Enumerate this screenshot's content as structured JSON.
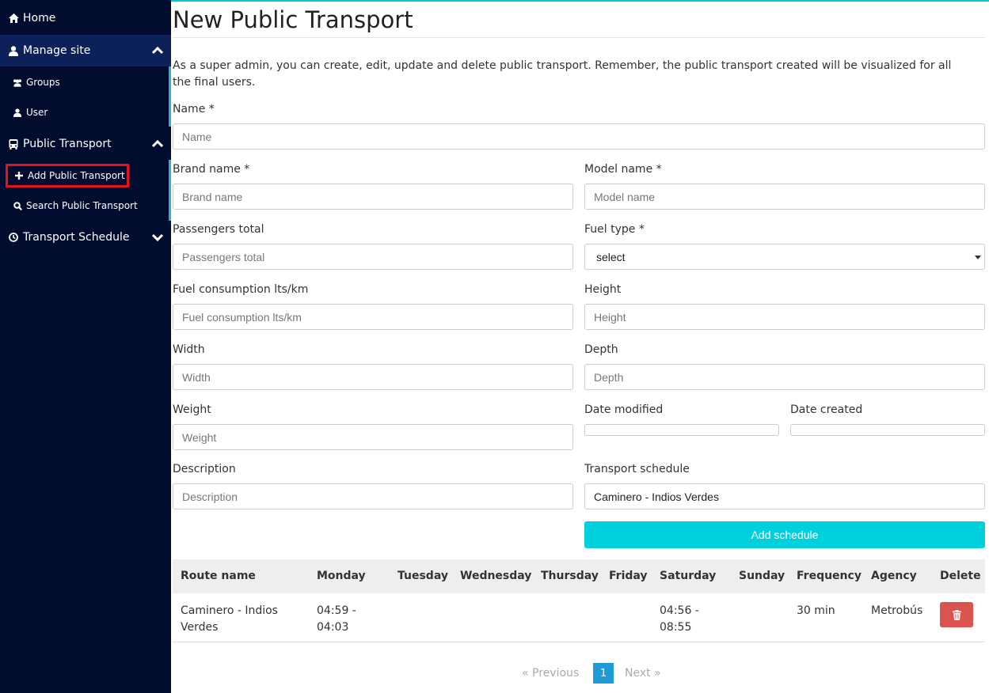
{
  "sidebar": {
    "home": "Home",
    "manage_site": "Manage site",
    "groups": "Groups",
    "user": "User",
    "public_transport": "Public Transport",
    "add_public_transport": "Add Public Transport",
    "search_public_transport": "Search Public Transport",
    "transport_schedule": "Transport Schedule"
  },
  "page": {
    "title": "New Public Transport",
    "intro": "As a super admin, you can create, edit, update and delete public transport. Remember, the public transport created will be visualized for all the final users."
  },
  "form": {
    "name": {
      "label": "Name *",
      "placeholder": "Name"
    },
    "brand": {
      "label": "Brand name *",
      "placeholder": "Brand name"
    },
    "model": {
      "label": "Model name *",
      "placeholder": "Model name"
    },
    "passengers": {
      "label": "Passengers total",
      "placeholder": "Passengers total"
    },
    "fuel_type": {
      "label": "Fuel type *",
      "value": "select"
    },
    "fuel_consumption": {
      "label": "Fuel consumption lts/km",
      "placeholder": "Fuel consumption lts/km"
    },
    "height": {
      "label": "Height",
      "placeholder": "Height"
    },
    "width": {
      "label": "Width",
      "placeholder": "Width"
    },
    "depth": {
      "label": "Depth",
      "placeholder": "Depth"
    },
    "weight": {
      "label": "Weight",
      "placeholder": "Weight"
    },
    "date_modified": {
      "label": "Date modified"
    },
    "date_created": {
      "label": "Date created"
    },
    "description": {
      "label": "Description",
      "placeholder": "Description"
    },
    "transport_schedule": {
      "label": "Transport schedule",
      "value": "Caminero - Indios Verdes"
    },
    "add_schedule": "Add schedule"
  },
  "table": {
    "headers": [
      "Route name",
      "Monday",
      "Tuesday",
      "Wednesday",
      "Thursday",
      "Friday",
      "Saturday",
      "Sunday",
      "Frequency",
      "Agency",
      "Delete"
    ],
    "rows": [
      {
        "route_name": "Caminero - Indios Verdes",
        "monday": "04:59 - 04:03",
        "tuesday": "",
        "wednesday": "",
        "thursday": "",
        "friday": "",
        "saturday": "04:56 - 08:55",
        "sunday": "",
        "frequency": "30 min",
        "agency": "Metrobús"
      }
    ]
  },
  "pagination": {
    "previous": "«  Previous",
    "current_page": "1",
    "next": "Next  »"
  },
  "colors": {
    "sidebar_bg": "#020c2e",
    "sidebar_active_bg": "#0c2059",
    "accent": "#00cfdc",
    "delete": "#d9534f",
    "page_active": "#1e9ad6",
    "highlight_border": "#e0141e"
  },
  "icons": {
    "home": "home-icon",
    "manage": "user-icon",
    "groups": "users-icon",
    "user": "user-icon",
    "transport": "bus-icon",
    "add": "plus-icon",
    "search": "search-icon",
    "schedule": "clock-icon",
    "delete": "trash-icon"
  }
}
